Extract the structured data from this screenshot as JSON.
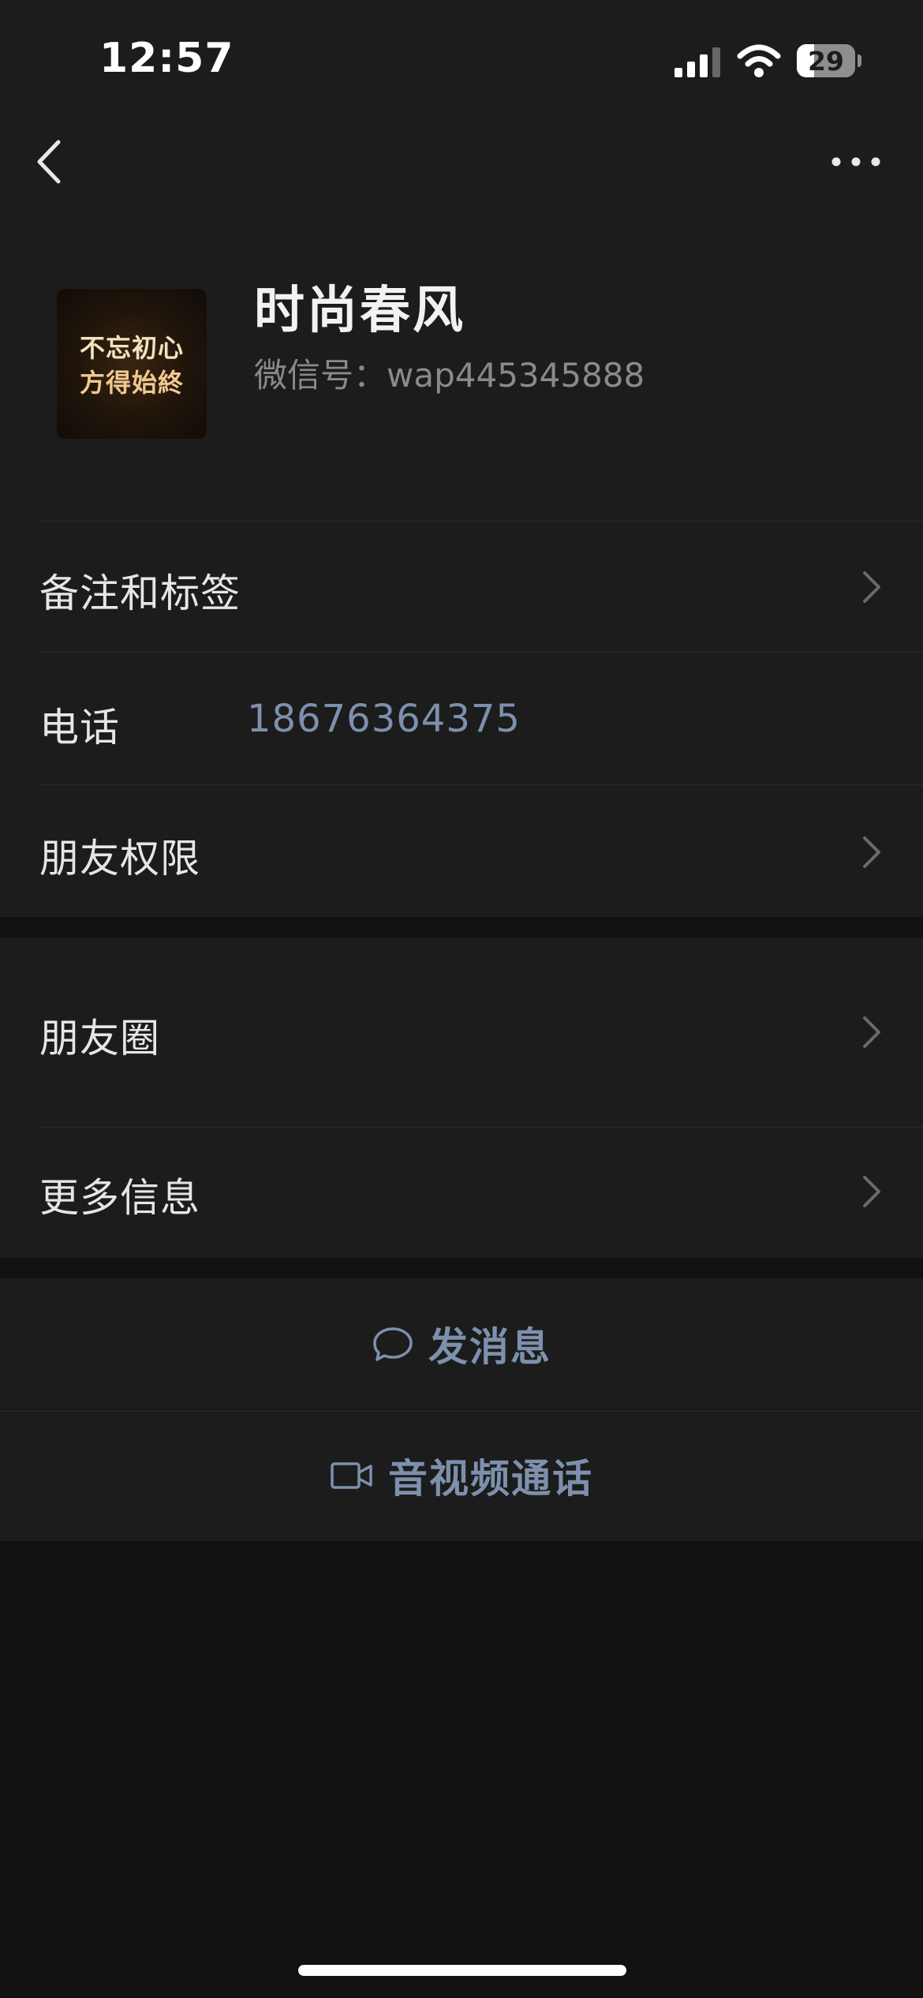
{
  "status_bar": {
    "time": "12:57",
    "battery": "29"
  },
  "profile": {
    "name": "时尚春风",
    "wechat_id": "微信号：wap445345888",
    "avatar_text": [
      "不忘初心",
      "方得始終"
    ]
  },
  "rows": {
    "remarks": "备注和标签",
    "phone_label": "电话",
    "phone_value": "18676364375",
    "friend_permissions": "朋友权限",
    "moments": "朋友圈",
    "more_info": "更多信息"
  },
  "actions": {
    "send_message": "发消息",
    "av_call": "音视频通话"
  },
  "colors": {
    "background": "#111111",
    "surface": "#1c1c1c",
    "accent_link": "#7d90ad",
    "text_primary": "#e6e6e6",
    "text_secondary": "#8a8a8a"
  },
  "icons": {
    "back": "chevron-left-icon",
    "more": "more-horizontal-icon",
    "chevron": "chevron-right-icon",
    "message": "chat-bubble-icon",
    "video": "video-camera-icon"
  }
}
